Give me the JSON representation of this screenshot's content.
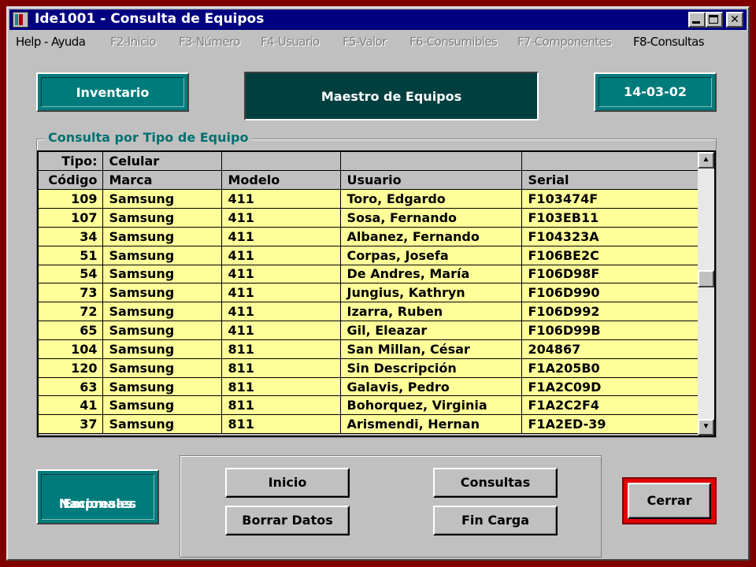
{
  "window": {
    "title": "Ide1001 - Consulta de Equipos",
    "minimize": "_",
    "maximize": "□",
    "close": "✕"
  },
  "menu": [
    {
      "label": "Help - Ayuda",
      "enabled": true
    },
    {
      "label": "F2-Inicio",
      "enabled": false
    },
    {
      "label": "F3-Número",
      "enabled": false
    },
    {
      "label": "F4-Usuario",
      "enabled": false
    },
    {
      "label": "F5-Valor",
      "enabled": false
    },
    {
      "label": "F6-Consumibles",
      "enabled": false
    },
    {
      "label": "F7-Componentes",
      "enabled": false
    },
    {
      "label": "F8-Consultas",
      "enabled": true
    }
  ],
  "header": {
    "inventario": "Inventario",
    "maestro": "Maestro de Equipos",
    "fecha": "14-03-02"
  },
  "group": {
    "title": "Consulta por Tipo de Equipo"
  },
  "grid": {
    "tipo_label": "Tipo:",
    "tipo_value": "Celular",
    "columns": [
      "Código",
      "Marca",
      "Modelo",
      "Usuario",
      "Serial"
    ],
    "rows": [
      [
        "109",
        "Samsung",
        "411",
        "Toro, Edgardo",
        "F103474F"
      ],
      [
        "107",
        "Samsung",
        "411",
        "Sosa, Fernando",
        "F103EB11"
      ],
      [
        "34",
        "Samsung",
        "411",
        "Albanez, Fernando",
        "F104323A"
      ],
      [
        "51",
        "Samsung",
        "411",
        "Corpas, Josefa",
        "F106BE2C"
      ],
      [
        "54",
        "Samsung",
        "411",
        "De Andres, María",
        "F106D98F"
      ],
      [
        "73",
        "Samsung",
        "411",
        "Jungius, Kathryn",
        "F106D990"
      ],
      [
        "72",
        "Samsung",
        "411",
        "Izarra, Ruben",
        "F106D992"
      ],
      [
        "65",
        "Samsung",
        "411",
        "Gil, Eleazar",
        "F106D99B"
      ],
      [
        "104",
        "Samsung",
        "811",
        "San Millan, César",
        "204867"
      ],
      [
        "120",
        "Samsung",
        "811",
        "Sin Descripción",
        "F1A205B0"
      ],
      [
        "63",
        "Samsung",
        "811",
        "Galavis, Pedro",
        "F1A2C09D"
      ],
      [
        "41",
        "Samsung",
        "811",
        "Bohorquez, Virginia",
        "F1A2C2F4"
      ],
      [
        "37",
        "Samsung",
        "811",
        "Arismendi, Hernan",
        "F1A2ED-39"
      ]
    ]
  },
  "footer": {
    "empresas_line1": "Empresas",
    "empresas_line2": "Nacionales",
    "buttons": {
      "inicio": "Inicio",
      "borrar": "Borrar Datos",
      "consultas": "Consultas",
      "fincarga": "Fin Carga",
      "cerrar": "Cerrar"
    }
  },
  "colors": {
    "title_bar": "#000080",
    "teal": "#007b7b",
    "dark_teal": "#003f3f",
    "grid_row": "#ffff99",
    "frame": "#800000",
    "cerrar_highlight": "#e00000"
  },
  "icons": {
    "app": "app-icon",
    "scroll_up": "scroll-up-arrow-icon",
    "scroll_down": "scroll-down-arrow-icon"
  }
}
